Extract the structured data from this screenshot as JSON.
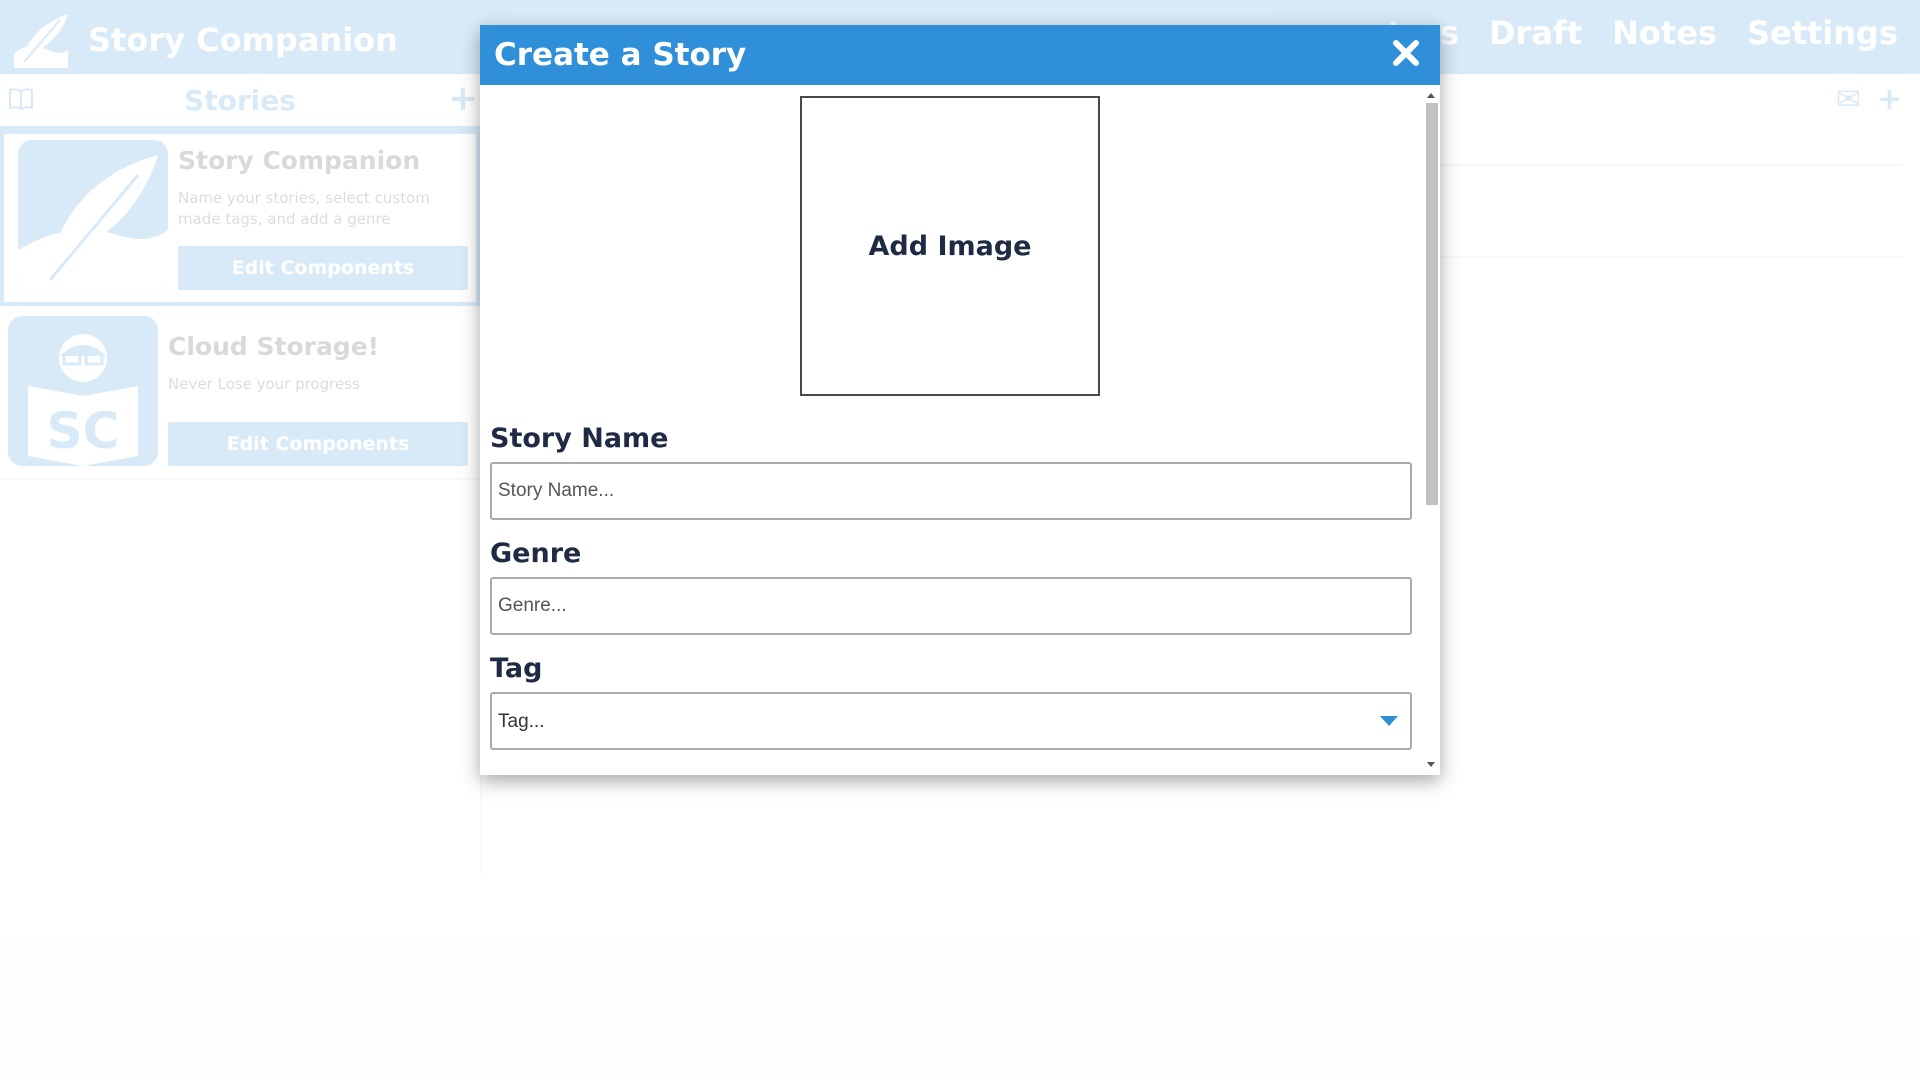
{
  "app": {
    "title": "Story Companion",
    "nav": [
      "racters",
      "Draft",
      "Notes",
      "Settings"
    ],
    "sidebar_title": "Stories",
    "stories": [
      {
        "title": "Story Companion",
        "description": "Name your stories, select custom made tags, and add a genre",
        "button": "Edit Components"
      },
      {
        "title": "Cloud Storage!",
        "description": "Never Lose your progress",
        "button": "Edit Components",
        "logo_text": "SC"
      }
    ]
  },
  "modal": {
    "title": "Create a Story",
    "image_label": "Add Image",
    "story_name": {
      "label": "Story Name",
      "placeholder": "Story Name...",
      "value": ""
    },
    "genre": {
      "label": "Genre",
      "placeholder": "Genre...",
      "value": ""
    },
    "tag": {
      "label": "Tag",
      "placeholder": "Tag..."
    }
  },
  "colors": {
    "primary": "#2f8fd8",
    "label_text": "#1f2a44"
  },
  "icons": {
    "close": "close-icon",
    "caret": "chevron-down-icon",
    "plus": "plus-icon",
    "mail": "mail-icon",
    "book": "book-icon",
    "feather": "feather-icon"
  }
}
